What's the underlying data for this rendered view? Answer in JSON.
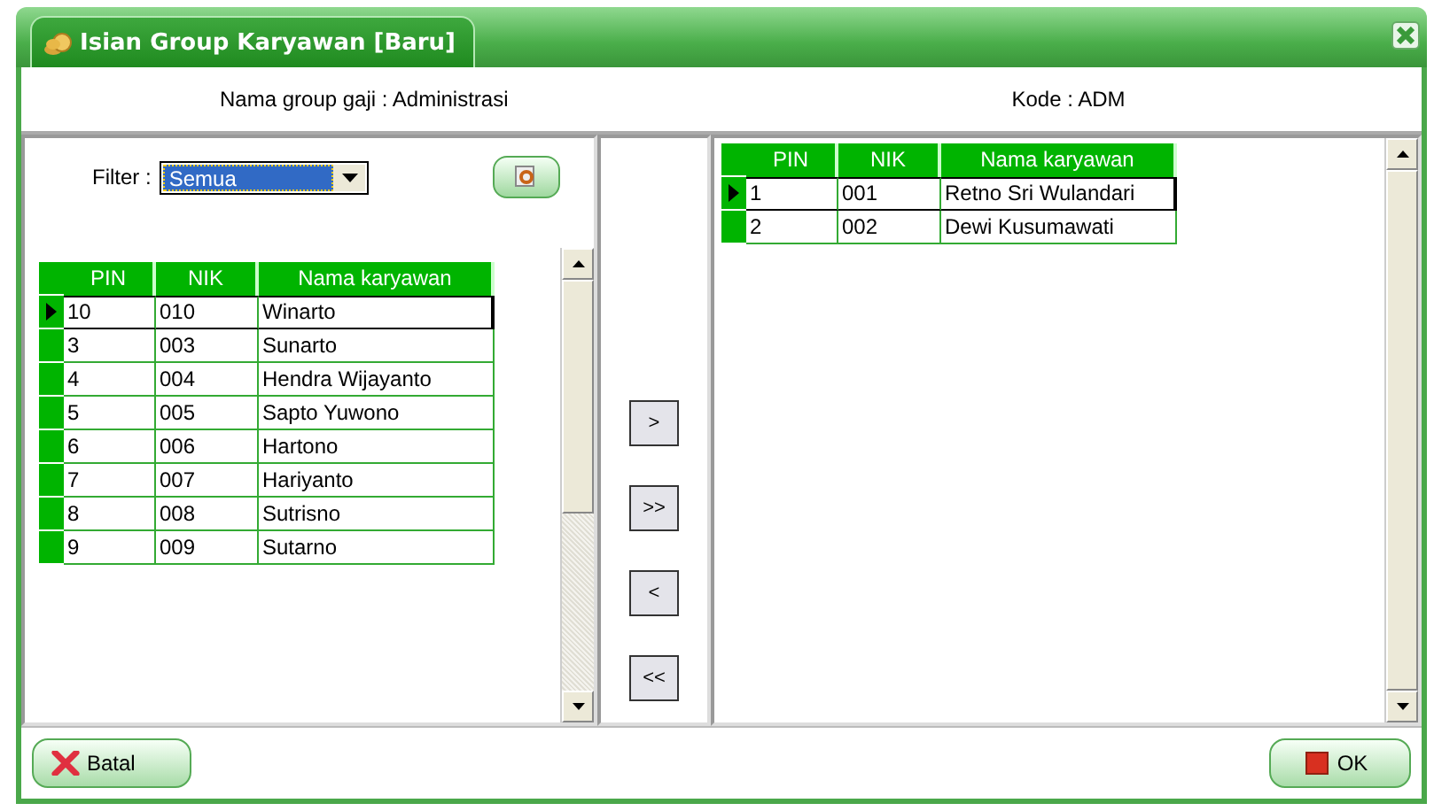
{
  "window": {
    "title": "Isian Group Karyawan [Baru]"
  },
  "header": {
    "group_label": "Nama group gaji :",
    "group_value": "Administrasi",
    "code_label": "Kode :",
    "code_value": "ADM"
  },
  "filter": {
    "label": "Filter :",
    "value": "Semua"
  },
  "left_table": {
    "columns": [
      "PIN",
      "NIK",
      "Nama karyawan"
    ],
    "rows": [
      {
        "cells": [
          "10",
          "010",
          "Winarto"
        ],
        "selected": true
      },
      {
        "cells": [
          "3",
          "003",
          "Sunarto"
        ],
        "selected": false
      },
      {
        "cells": [
          "4",
          "004",
          "Hendra Wijayanto"
        ],
        "selected": false
      },
      {
        "cells": [
          "5",
          "005",
          "Sapto Yuwono"
        ],
        "selected": false
      },
      {
        "cells": [
          "6",
          "006",
          "Hartono"
        ],
        "selected": false
      },
      {
        "cells": [
          "7",
          "007",
          "Hariyanto"
        ],
        "selected": false
      },
      {
        "cells": [
          "8",
          "008",
          "Sutrisno"
        ],
        "selected": false
      },
      {
        "cells": [
          "9",
          "009",
          "Sutarno"
        ],
        "selected": false
      }
    ]
  },
  "move_buttons": [
    ">",
    ">>",
    "<",
    "<<"
  ],
  "right_table": {
    "columns": [
      "PIN",
      "NIK",
      "Nama karyawan"
    ],
    "rows": [
      {
        "cells": [
          "1",
          "001",
          "Retno Sri  Wulandari"
        ],
        "selected": true
      },
      {
        "cells": [
          "2",
          "002",
          "Dewi Kusumawati"
        ],
        "selected": false
      }
    ]
  },
  "buttons": [
    {
      "label": "Batal",
      "kind": "cancel"
    },
    {
      "label": "OK",
      "kind": "ok"
    }
  ]
}
